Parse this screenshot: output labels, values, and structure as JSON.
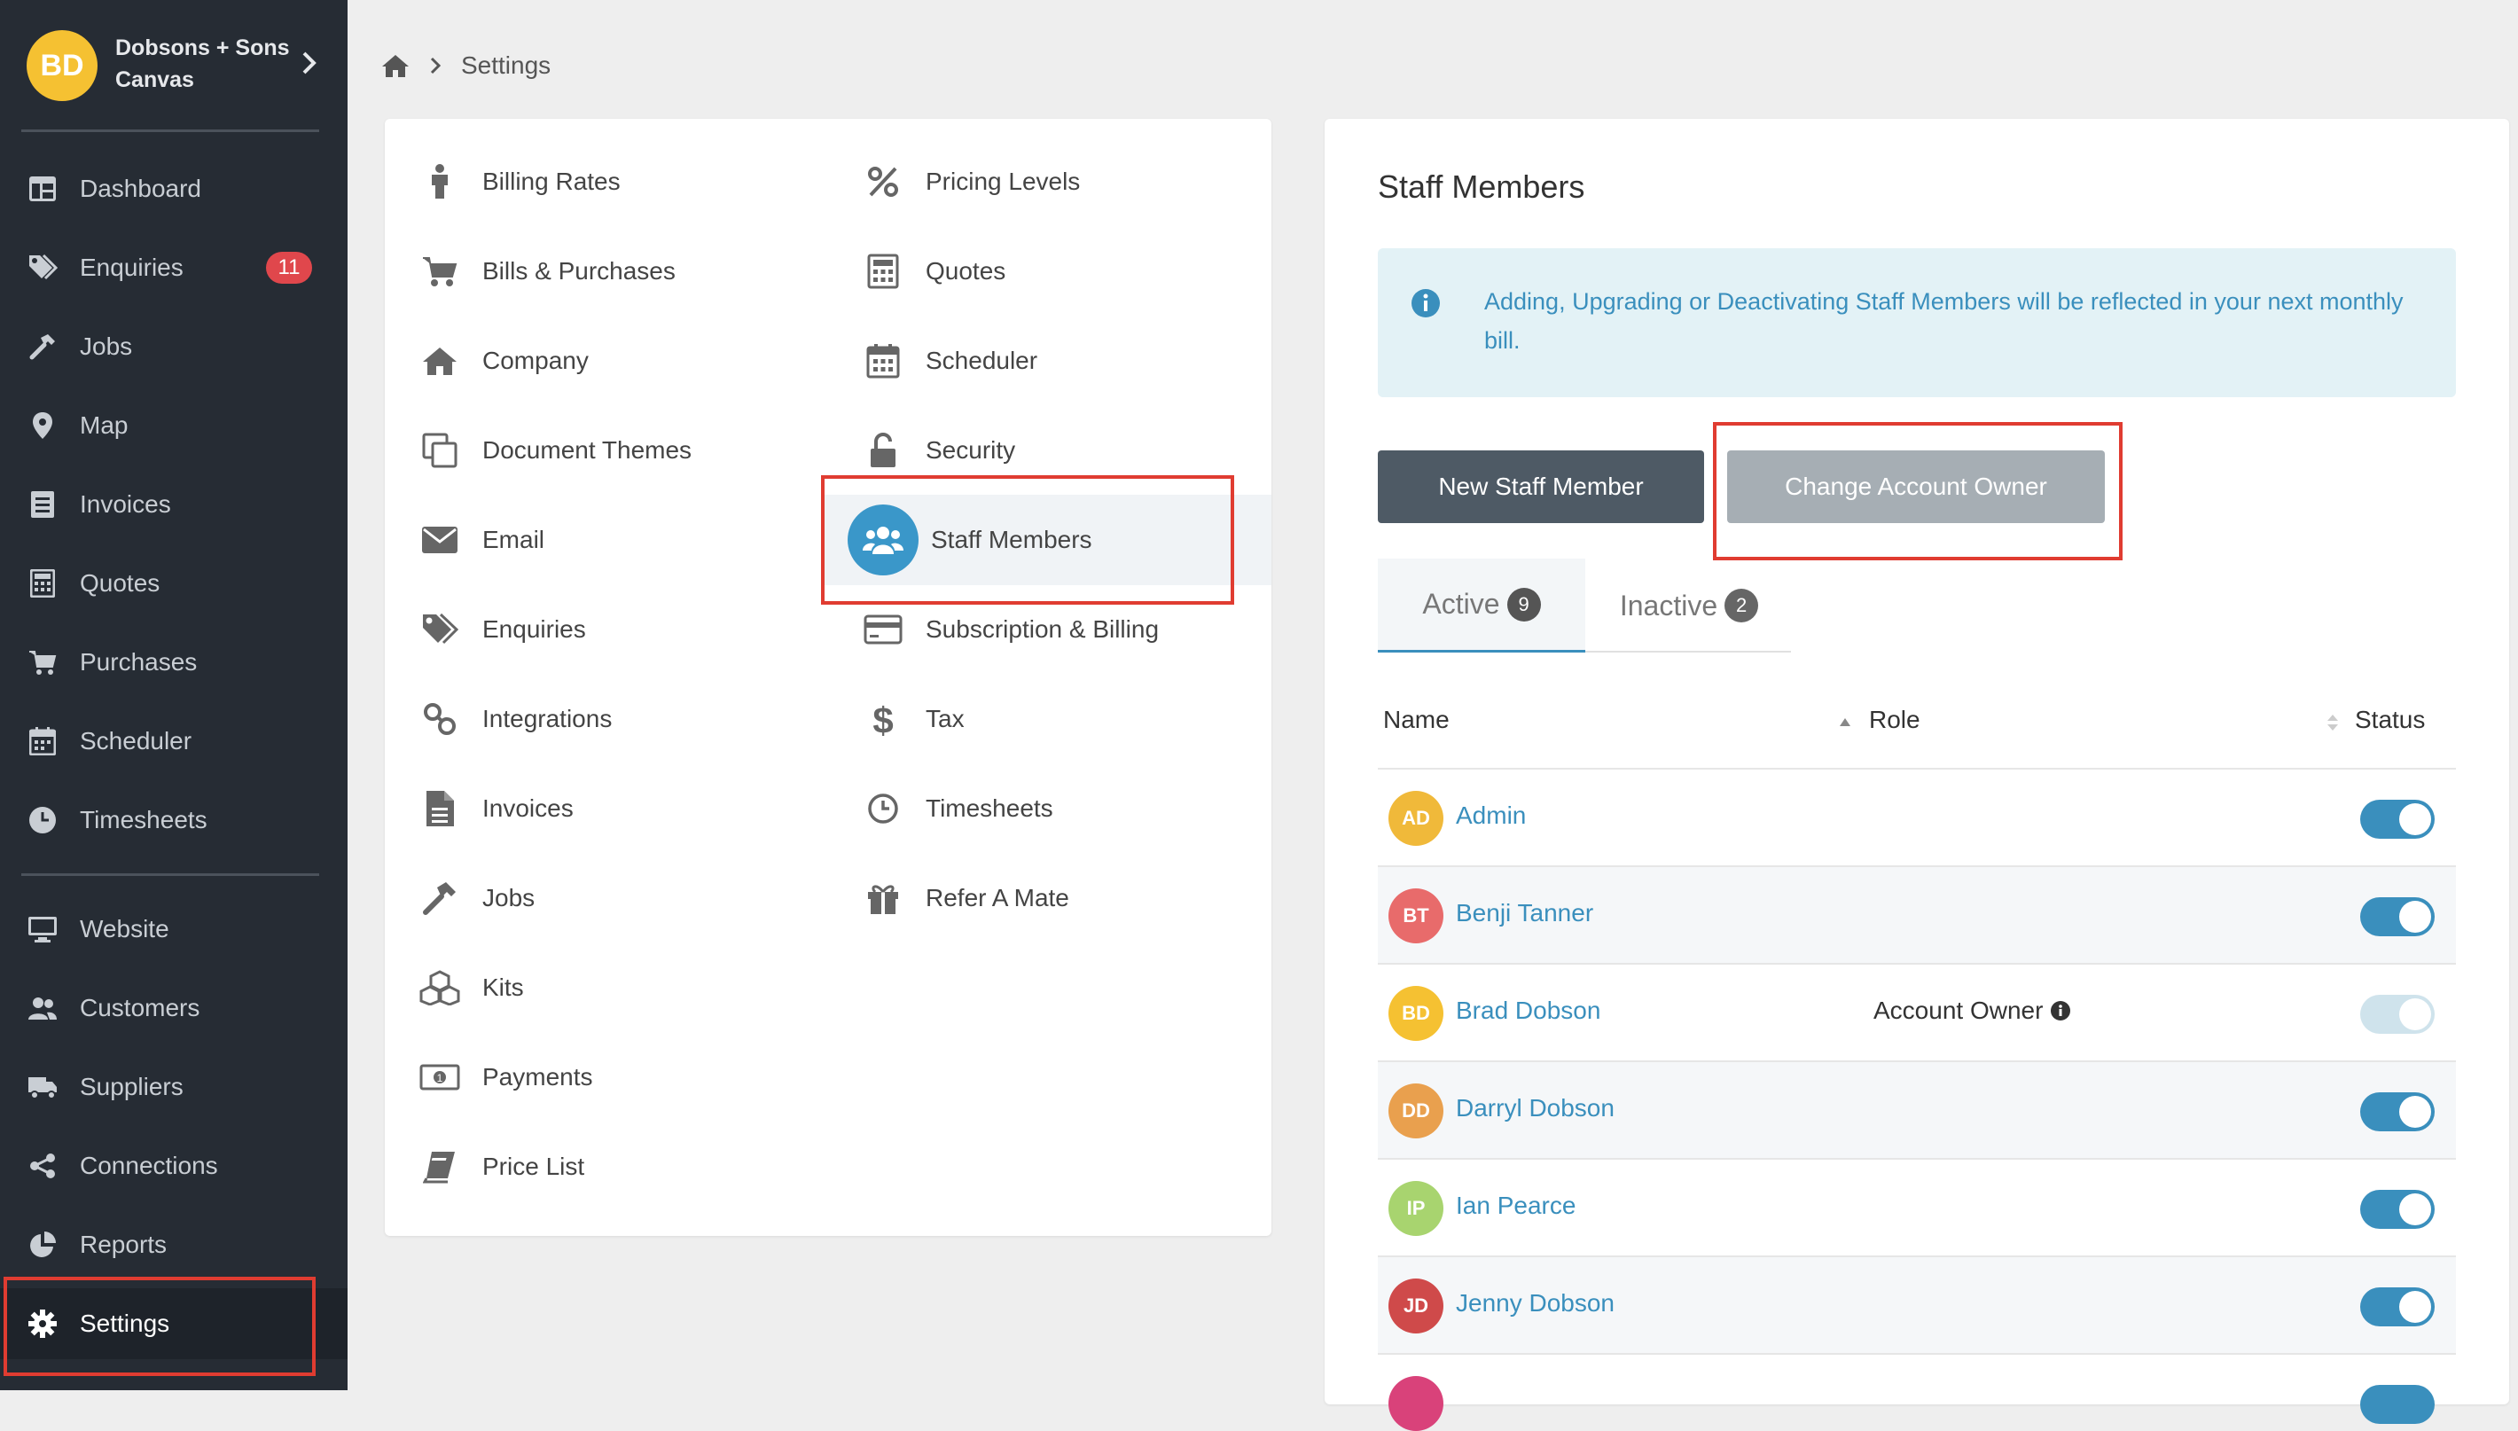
{
  "org": {
    "initials": "BD",
    "name": "Dobsons + Sons Canvas"
  },
  "sidebar": {
    "items": [
      {
        "label": "Dashboard",
        "icon": "dashboard-icon"
      },
      {
        "label": "Enquiries",
        "icon": "tags-icon",
        "badge": "11"
      },
      {
        "label": "Jobs",
        "icon": "hammer-icon"
      },
      {
        "label": "Map",
        "icon": "map-pin-icon"
      },
      {
        "label": "Invoices",
        "icon": "invoice-icon"
      },
      {
        "label": "Quotes",
        "icon": "calculator-icon"
      },
      {
        "label": "Purchases",
        "icon": "cart-icon"
      },
      {
        "label": "Scheduler",
        "icon": "calendar-icon"
      },
      {
        "label": "Timesheets",
        "icon": "clock-icon"
      },
      {
        "label": "Website",
        "icon": "monitor-icon"
      },
      {
        "label": "Customers",
        "icon": "users-icon"
      },
      {
        "label": "Suppliers",
        "icon": "truck-icon"
      },
      {
        "label": "Connections",
        "icon": "share-icon"
      },
      {
        "label": "Reports",
        "icon": "pie-chart-icon"
      },
      {
        "label": "Settings",
        "icon": "gear-icon",
        "active": true
      }
    ]
  },
  "breadcrumb": {
    "current": "Settings"
  },
  "settings_menu": {
    "left": [
      "Billing Rates",
      "Bills & Purchases",
      "Company",
      "Document Themes",
      "Email",
      "Enquiries",
      "Integrations",
      "Invoices",
      "Jobs",
      "Kits",
      "Payments",
      "Price List"
    ],
    "right": [
      "Pricing Levels",
      "Quotes",
      "Scheduler",
      "Security",
      "Staff Members",
      "Subscription & Billing",
      "Tax",
      "Timesheets",
      "Refer A Mate"
    ],
    "selected": "Staff Members"
  },
  "panel": {
    "title": "Staff Members",
    "info": "Adding, Upgrading or Deactivating Staff Members will be reflected in your next monthly bill.",
    "new_button": "New Staff Member",
    "change_owner_button": "Change Account Owner",
    "tabs": [
      {
        "label": "Active",
        "count": "9"
      },
      {
        "label": "Inactive",
        "count": "2"
      }
    ],
    "columns": {
      "name": "Name",
      "role": "Role",
      "status": "Status"
    },
    "staff": [
      {
        "initials": "AD",
        "name": "Admin",
        "role": "",
        "color": "#f0b93a",
        "active": true
      },
      {
        "initials": "BT",
        "name": "Benji Tanner",
        "role": "",
        "color": "#e86b6b",
        "active": true
      },
      {
        "initials": "BD",
        "name": "Brad Dobson",
        "role": "Account Owner",
        "color": "#f5c132",
        "active": true,
        "locked": true
      },
      {
        "initials": "DD",
        "name": "Darryl Dobson",
        "role": "",
        "color": "#e9a04e",
        "active": true
      },
      {
        "initials": "IP",
        "name": "Ian Pearce",
        "role": "",
        "color": "#a8d46f",
        "active": true
      },
      {
        "initials": "JD",
        "name": "Jenny Dobson",
        "role": "",
        "color": "#cf4a4a",
        "active": true
      }
    ]
  },
  "colors": {
    "sidebar_bg": "#262c34",
    "accent": "#3a8fbd",
    "highlight": "#e03c31"
  }
}
